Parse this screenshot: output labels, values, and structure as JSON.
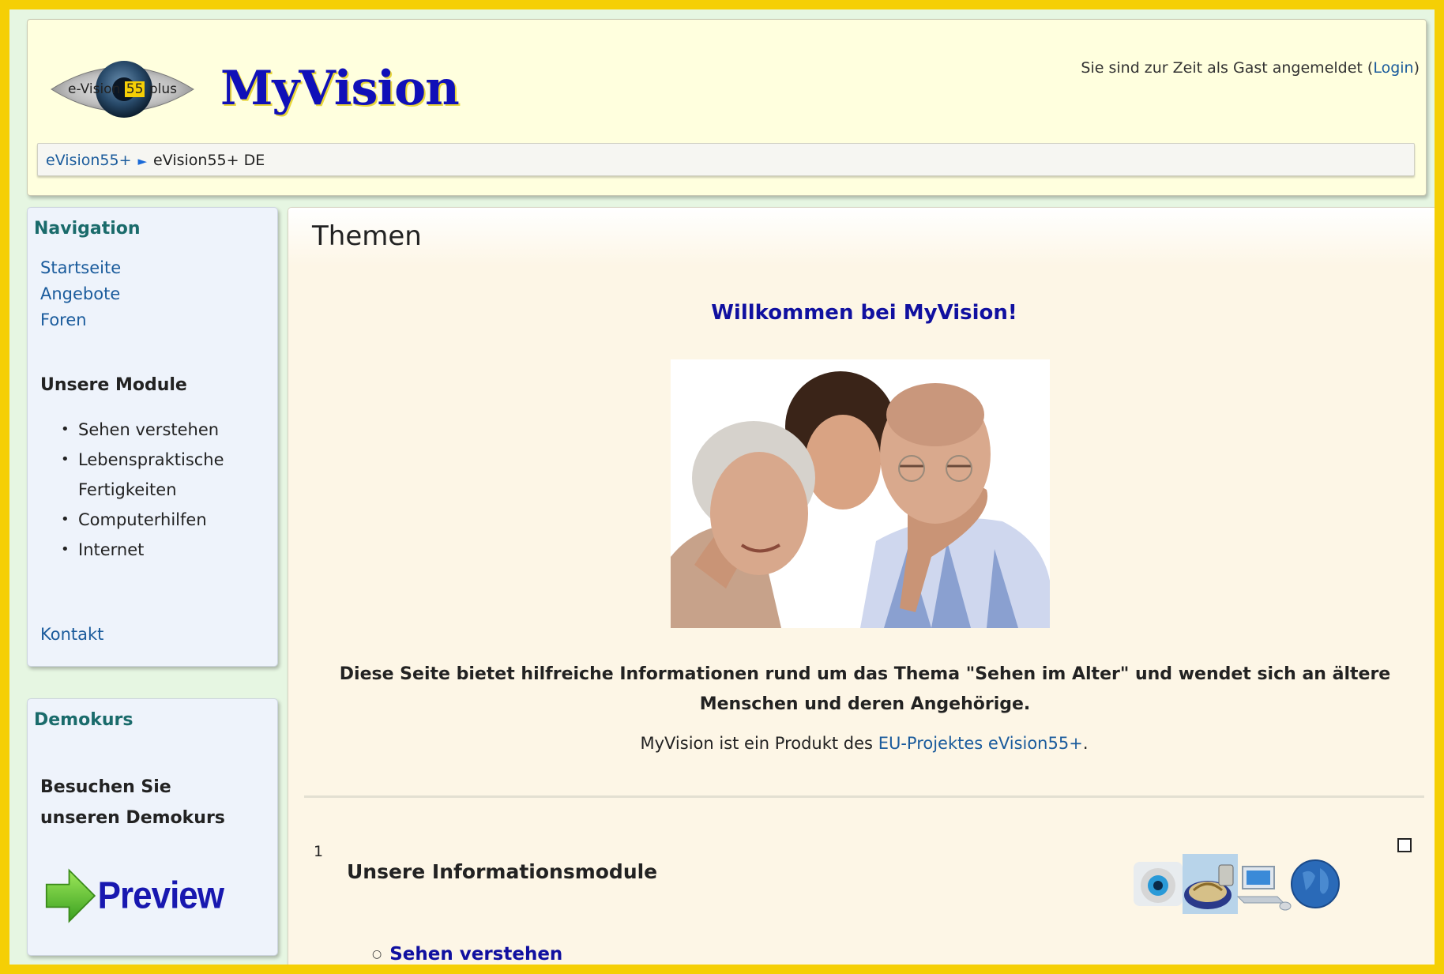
{
  "header": {
    "logo_prefix": "e-Vision",
    "logo_highlight": "55",
    "logo_suffix": "plus",
    "site_title": "MyVision",
    "login_text": "Sie sind zur Zeit als Gast angemeldet (",
    "login_link": "Login",
    "login_close": ")"
  },
  "breadcrumb": {
    "root": "eVision55+",
    "separator": "►",
    "current": "eVision55+ DE"
  },
  "navigation": {
    "title": "Navigation",
    "links": [
      "Startseite",
      "Angebote",
      "Foren"
    ],
    "modules_heading": "Unsere Module",
    "modules": [
      "Sehen verstehen",
      "Lebenspraktische Fertigkeiten",
      "Computerhilfen",
      "Internet"
    ],
    "contact": "Kontakt"
  },
  "demo": {
    "title": "Demokurs",
    "text": "Besuchen Sie unseren Demokurs",
    "preview_label": "Preview"
  },
  "main": {
    "title": "Themen",
    "welcome": "Willkommen bei MyVision!",
    "intro": "Diese Seite bietet hilfreiche Informationen rund um das Thema \"Sehen im Alter\" und wendet sich an ältere Menschen und deren Angehörige.",
    "product_text": "MyVision ist ein Produkt des ",
    "product_link": "EU-Projektes eVision55+",
    "product_end": ".",
    "section_number": "1",
    "section_title": "Unsere Informationsmodule",
    "section_items": [
      "Sehen verstehen"
    ],
    "section_icons": [
      "eye-icon",
      "food-icon",
      "computer-icon",
      "globe-icon"
    ]
  },
  "colors": {
    "outer_border": "#f5cf05",
    "title_blue": "#1010b8",
    "link": "#1a5b9c",
    "block_title": "#1a6b6b"
  }
}
